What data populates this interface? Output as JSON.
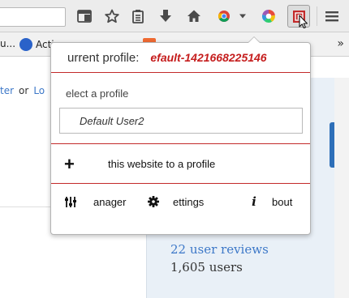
{
  "toolbar": {
    "url_value": "",
    "icons": [
      "reader-view-icon",
      "bookmark-star-icon",
      "bookmarks-list-icon",
      "download-icon",
      "home-icon",
      "chrome-icon",
      "dropdown-arrow-icon",
      "color-wheel-icon",
      "profile-extension-icon",
      "hamburger-menu-icon"
    ]
  },
  "bookmarks": {
    "items": [
      {
        "label": "u..."
      },
      {
        "label": "Acti"
      },
      {
        "label": ""
      }
    ],
    "overflow": "»"
  },
  "page": {
    "signin_register": "ter",
    "signin_or": "or",
    "signin_login": "Lo",
    "reviews": "22 user reviews",
    "users": "1,605 users"
  },
  "popup": {
    "current_profile_label": "urrent profile:",
    "current_profile_value": "efault-1421668225146",
    "select_label": "elect a profile",
    "selected_profile": "Default User2",
    "add_symbol": "+",
    "add_label": "this website to a profile",
    "manager_label": "anager",
    "settings_label": "ettings",
    "about_symbol": "i",
    "about_label": "bout",
    "accent_color": "#c32a2a"
  }
}
